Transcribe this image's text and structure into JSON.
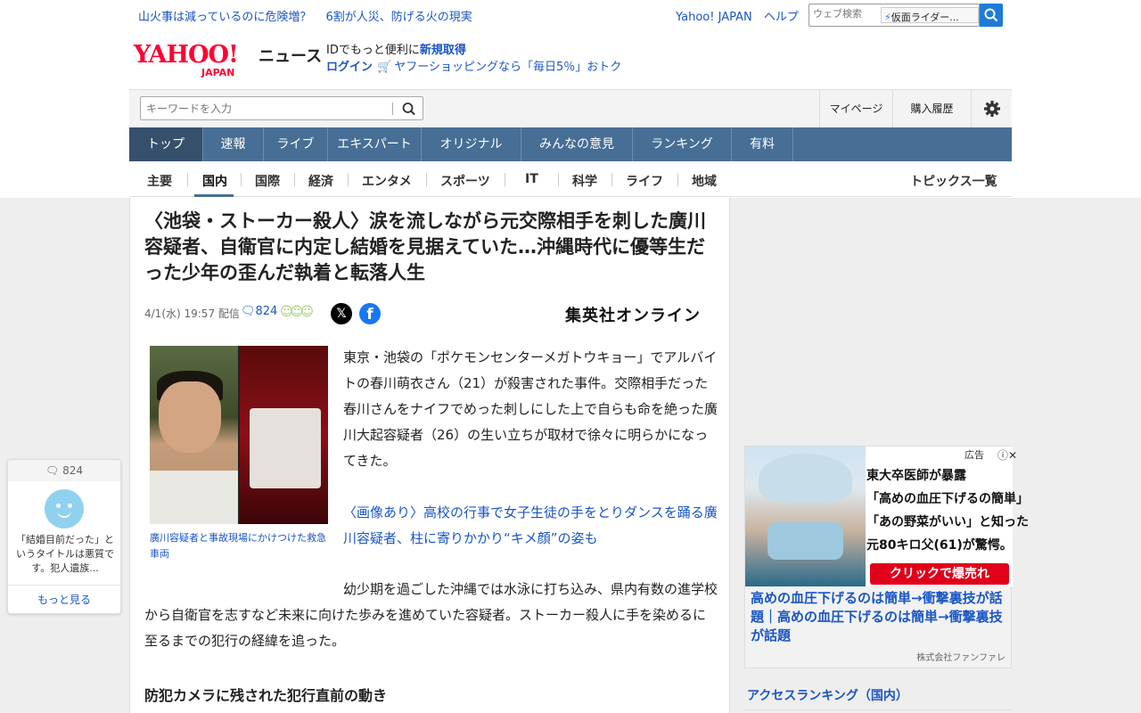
{
  "topbar": {
    "links": [
      "山火事は減っているのに危険増？",
      "6割が人災、防げる火の現実"
    ],
    "right_links": [
      "Yahoo! JAPAN",
      "ヘルプ"
    ],
    "web_search_placeholder": "ウェブ検索",
    "web_search_suggest": "仮面ライダー..."
  },
  "brand": {
    "logo": "YAHOO!",
    "logo_sub": "JAPAN",
    "section": "ニュース"
  },
  "promo": {
    "line1_prefix": "IDでもっと便利に",
    "line1_link": "新規取得",
    "login": "ログイン",
    "shopping": "ヤフーショッピングなら「毎日5％」おトク"
  },
  "search": {
    "placeholder": "キーワードを入力",
    "mypage": "マイページ",
    "history": "購入履歴"
  },
  "main_nav": [
    {
      "label": "トップ",
      "active": true
    },
    {
      "label": "速報"
    },
    {
      "label": "ライブ"
    },
    {
      "label": "エキスパート"
    },
    {
      "label": "オリジナル"
    },
    {
      "label": "みんなの意見"
    },
    {
      "label": "ランキング"
    },
    {
      "label": "有料"
    }
  ],
  "categories": [
    "主要",
    "国内",
    "国際",
    "経済",
    "エンタメ",
    "スポーツ",
    "IT",
    "科学",
    "ライフ",
    "地域"
  ],
  "active_category": "国内",
  "topics_all": "トピックス一覧",
  "article": {
    "headline": "〈池袋・ストーカー殺人〉涙を流しながら元交際相手を刺した廣川容疑者、自衛官に内定し結婚を見据えていた…沖縄時代に優等生だった少年の歪んだ執着と転落人生",
    "date": "4/1(水) 19:57 配信",
    "comment_count": "824",
    "publisher": "集英社オンライン",
    "photo_caption": "廣川容疑者と事故現場にかけつけた救急車両",
    "para1": "東京・池袋の「ポケモンセンターメガトウキョー」でアルバイトの春川萌衣さん（21）が殺害された事件。交際相手だった春川さんをナイフでめった刺しにした上で自らも命を絶った廣川大起容疑者（26）の生い立ちが取材で徐々に明らかになってきた。",
    "related_link": "〈画像あり〉高校の行事で女子生徒の手をとりダンスを踊る廣川容疑者、柱に寄りかかり“キメ顔”の姿も",
    "para2": "幼少期を過ごした沖縄では水泳に打ち込み、県内有数の進学校から自衛官を志すなど未来に向けた歩みを進めていた容疑者。ストーカー殺人に手を染めるに至るまでの犯行の経緯を追った。",
    "section_heading": "防犯カメラに残された犯行直前の動き"
  },
  "comment_widget": {
    "count": "824",
    "snippet": "「結婚目前だった」というタイトルは悪質です。犯人遺族...",
    "more": "もっと見る"
  },
  "ad": {
    "label": "広告",
    "lines": [
      "東大卒医師が暴露",
      "「高めの血圧下げるの簡単」",
      "「あの野菜がいい」と知った",
      "元80キロ父(61)が驚愕。"
    ],
    "cta": "クリックで爆売れ",
    "title": "高めの血圧下げるのは簡単→衝撃裏技が話題｜高めの血圧下げるのは簡単→衝撃裏技が話題",
    "sponsor": "株式会社ファンファレ"
  },
  "ranking_heading": "アクセスランキング（国内）",
  "colors": {
    "accent_blue": "#1a56c4",
    "nav_bg": "#476e95",
    "yahoo_red": "#ff0033",
    "search_btn": "#1e7bd8"
  }
}
